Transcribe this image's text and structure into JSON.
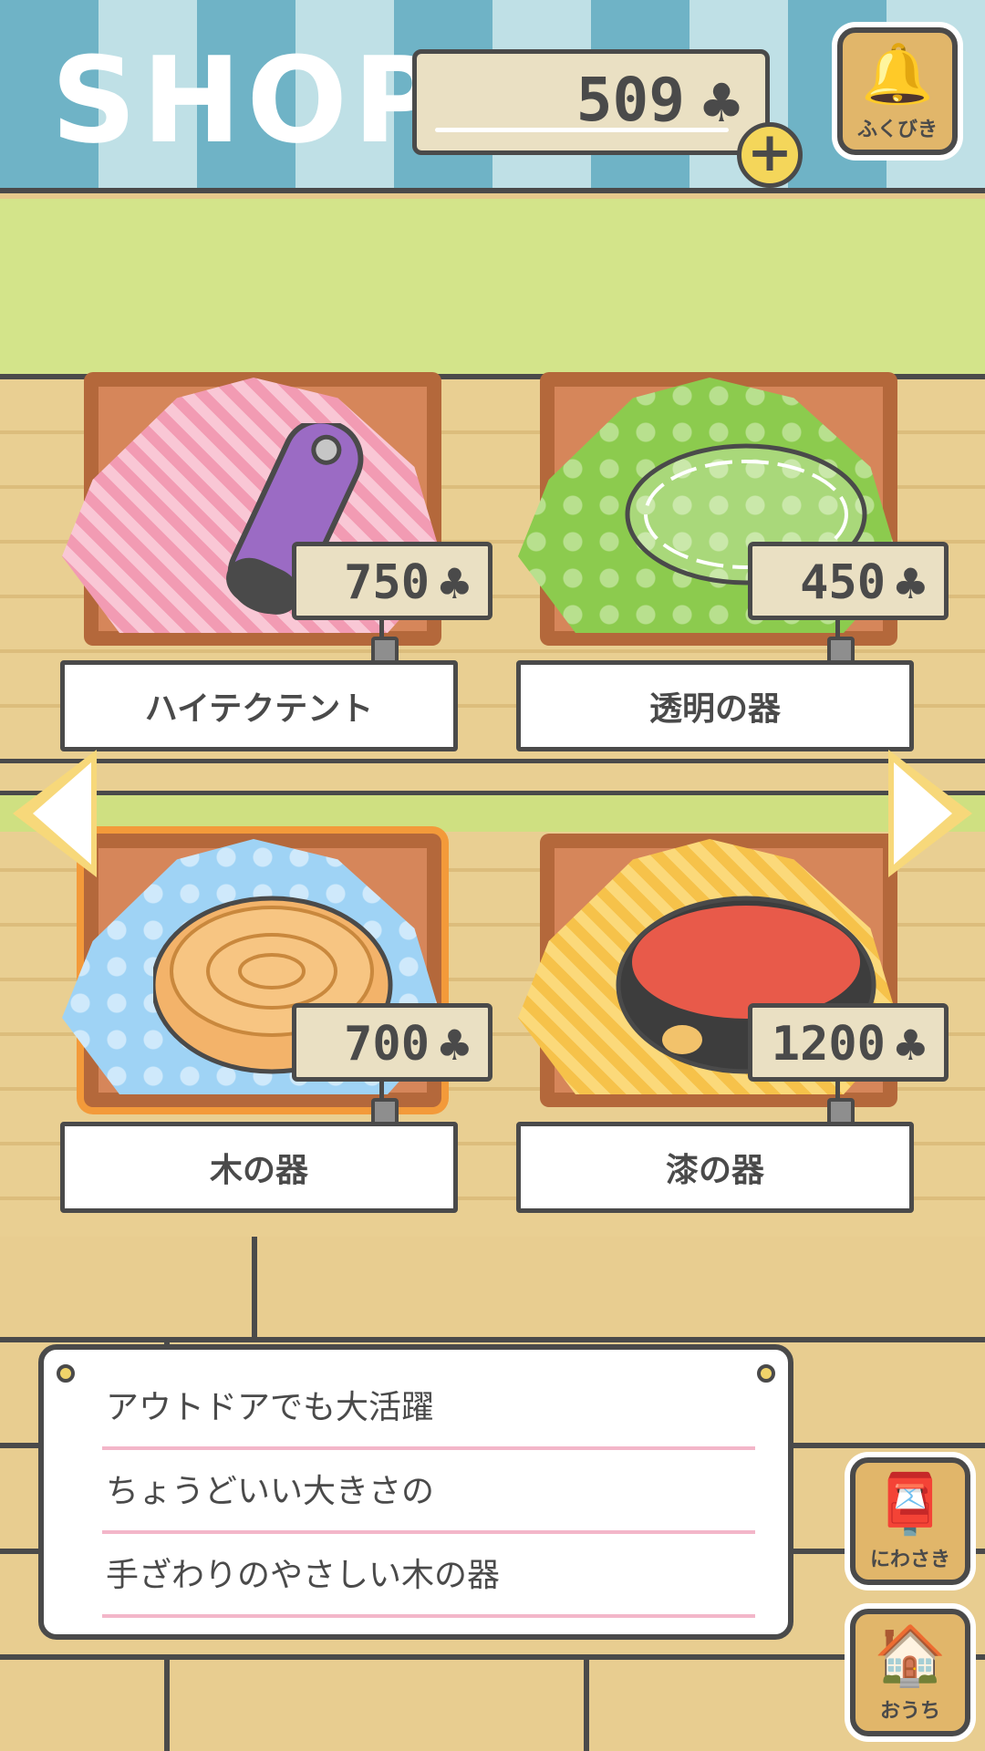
{
  "header": {
    "title": "SHOP",
    "coins": "509",
    "currency_icon": "clover-icon",
    "add_coins_label": "+",
    "lottery_label": "ふくびき"
  },
  "items": [
    {
      "name": "ハイテクテント",
      "price": "750",
      "cloth": "pink",
      "selected": false
    },
    {
      "name": "透明の器",
      "price": "450",
      "cloth": "green",
      "selected": false
    },
    {
      "name": "木の器",
      "price": "700",
      "cloth": "blue",
      "selected": true
    },
    {
      "name": "漆の器",
      "price": "1200",
      "cloth": "yellow",
      "selected": false
    }
  ],
  "description": {
    "lines": [
      "アウトドアでも大活躍",
      "ちょうどいい大きさの",
      "手ざわりのやさしい木の器"
    ]
  },
  "nav": {
    "garden_label": "にわさき",
    "home_label": "おうち"
  },
  "colors": {
    "outline": "#4a4a4a",
    "header_stripe_dark": "#6fb3c6",
    "header_stripe_light": "#bfe0e6",
    "grass": "#d3e48a",
    "wood": "#e9cf92",
    "selection": "#f39a3a",
    "description_rule": "#f3b6c9"
  }
}
